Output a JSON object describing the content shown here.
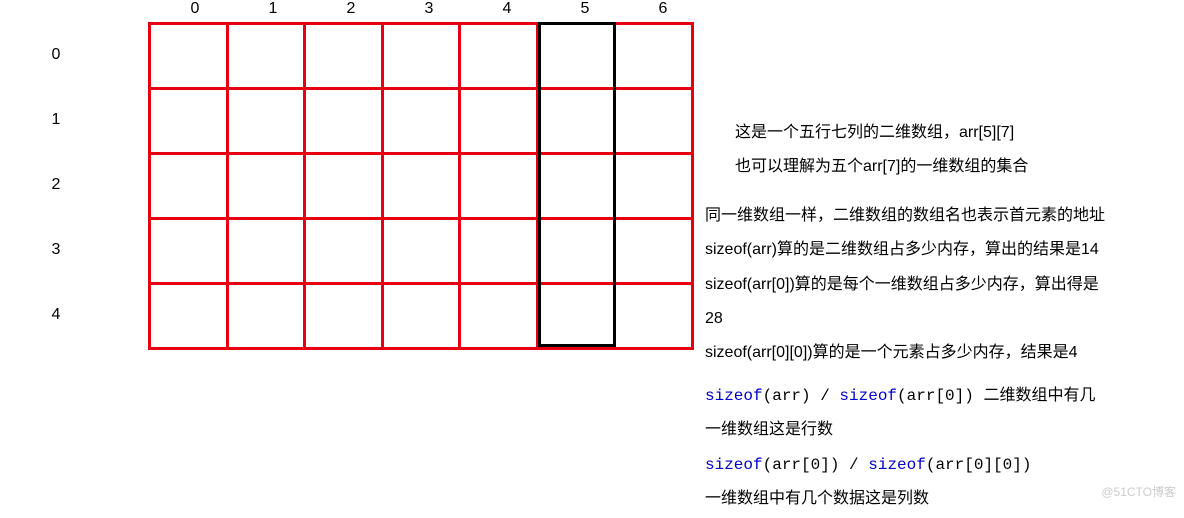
{
  "grid": {
    "cols": [
      "0",
      "1",
      "2",
      "3",
      "4",
      "5",
      "6"
    ],
    "rows": [
      "0",
      "1",
      "2",
      "3",
      "4"
    ],
    "highlight_col_index": 5
  },
  "text": {
    "intro1": "这是一个五行七列的二维数组，arr[5][7]",
    "intro2": "也可以理解为五个arr[7]的一维数组的集合",
    "p1": "同一维数组一样，二维数组的数组名也表示首元素的地址",
    "p2": "sizeof(arr)算的是二维数组占多少内存，算出的结果是14",
    "p3": "sizeof(arr[0])算的是每个一维数组占多少内存，算出得是",
    "p3b": "28",
    "p4": "sizeof(arr[0][0])算的是一个元素占多少内存，结果是4",
    "c1a": "sizeof",
    "c1b": "(arr) / ",
    "c1c": "sizeof",
    "c1d": "(arr[0]) 二维数组中有几",
    "c1e": "一维数组这是行数",
    "c2a": "sizeof",
    "c2b": "(arr[0]) / ",
    "c2c": "sizeof",
    "c2d": "(arr[0][0])",
    "c2e": "一维数组中有几个数据这是列数"
  },
  "watermark": "@51CTO博客"
}
